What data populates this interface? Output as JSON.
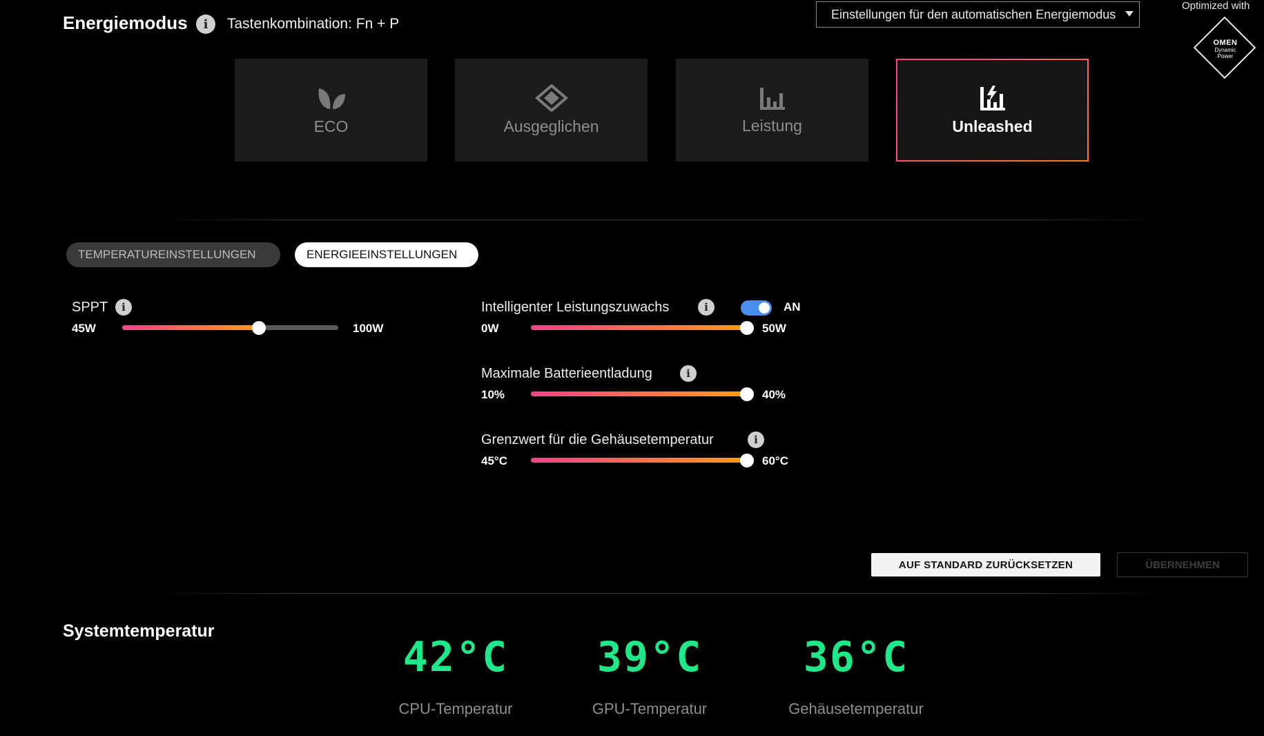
{
  "header": {
    "title": "Energiemodus",
    "shortcut": "Tastenkombination: Fn + P",
    "auto_dropdown": "Einstellungen für den automatischen Energiemodus",
    "optimized_label": "Optimized with",
    "omen_logo": {
      "name": "OMEN",
      "line1": "Dynamic",
      "line2": "Power"
    }
  },
  "modes": [
    {
      "label": "ECO",
      "icon": "leaf-icon",
      "active": false
    },
    {
      "label": "Ausgeglichen",
      "icon": "diamond-icon",
      "active": false
    },
    {
      "label": "Leistung",
      "icon": "bar-chart-icon",
      "active": false
    },
    {
      "label": "Unleashed",
      "icon": "lightning-bars-icon",
      "active": true
    }
  ],
  "tabs": {
    "temperature": "TEMPERATUREINSTELLUNGEN",
    "energy": "ENERGIEEINSTELLUNGEN",
    "active": "energy"
  },
  "sliders": {
    "sppt": {
      "label": "SPPT",
      "min": "45W",
      "max": "100W",
      "fraction": 0.63
    },
    "boost": {
      "label": "Intelligenter Leistungszuwachs",
      "min": "0W",
      "max": "50W",
      "fraction": 1.0,
      "toggle_label": "AN",
      "toggle_on": true
    },
    "battery": {
      "label": "Maximale Batterieentladung",
      "min": "10%",
      "max": "40%",
      "fraction": 1.0
    },
    "chassis": {
      "label": "Grenzwert für die Gehäusetemperatur",
      "min": "45°C",
      "max": "60°C",
      "fraction": 1.0
    }
  },
  "buttons": {
    "reset": "AUF STANDARD ZURÜCKSETZEN",
    "apply": "ÜBERNEHMEN"
  },
  "system": {
    "title": "Systemtemperatur",
    "cpu": {
      "value": "42°C",
      "label": "CPU-Temperatur"
    },
    "gpu": {
      "value": "39°C",
      "label": "GPU-Temperatur"
    },
    "chassis": {
      "value": "36°C",
      "label": "Gehäusetemperatur"
    }
  },
  "colors": {
    "accent_start": "#f0458a",
    "accent_end": "#ff9a1a",
    "temp_green": "#1ee88a",
    "toggle_blue": "#4a8ef0"
  }
}
